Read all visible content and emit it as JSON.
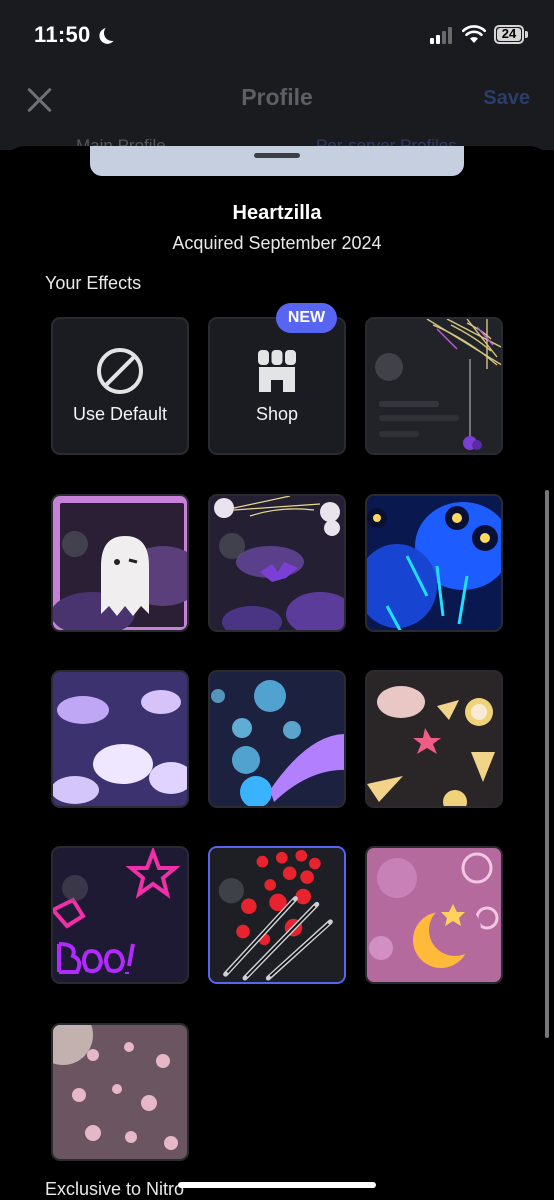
{
  "status_bar": {
    "time": "11:50",
    "battery": "24"
  },
  "header": {
    "title": "Profile",
    "save_label": "Save",
    "tab_main": "Main Profile",
    "tab_server": "Per-server Profiles"
  },
  "sheet": {
    "item_name": "Heartzilla",
    "acquired": "Acquired September 2024",
    "section_title": "Your Effects",
    "next_section_title": "Exclusive to Nitro",
    "new_badge": "NEW",
    "tiles": [
      {
        "label": "Use Default",
        "icon": "ban-icon"
      },
      {
        "label": "Shop",
        "icon": "shop-icon"
      },
      {
        "effect": "spiderweb-effect"
      },
      {
        "effect": "ghost-effect"
      },
      {
        "effect": "bats-and-webs-effect"
      },
      {
        "effect": "blue-skulls-effect"
      },
      {
        "effect": "purple-clouds-effect"
      },
      {
        "effect": "bubbles-effect"
      },
      {
        "effect": "snacks-effect"
      },
      {
        "effect": "boo-neon-effect"
      },
      {
        "effect": "heartzilla-claws-effect",
        "selected": true
      },
      {
        "effect": "crescent-moon-effect"
      },
      {
        "effect": "sakura-petals-effect"
      }
    ]
  },
  "colors": {
    "accent": "#5865f2",
    "background": "#000000",
    "header_bg": "#1a1b1f"
  }
}
